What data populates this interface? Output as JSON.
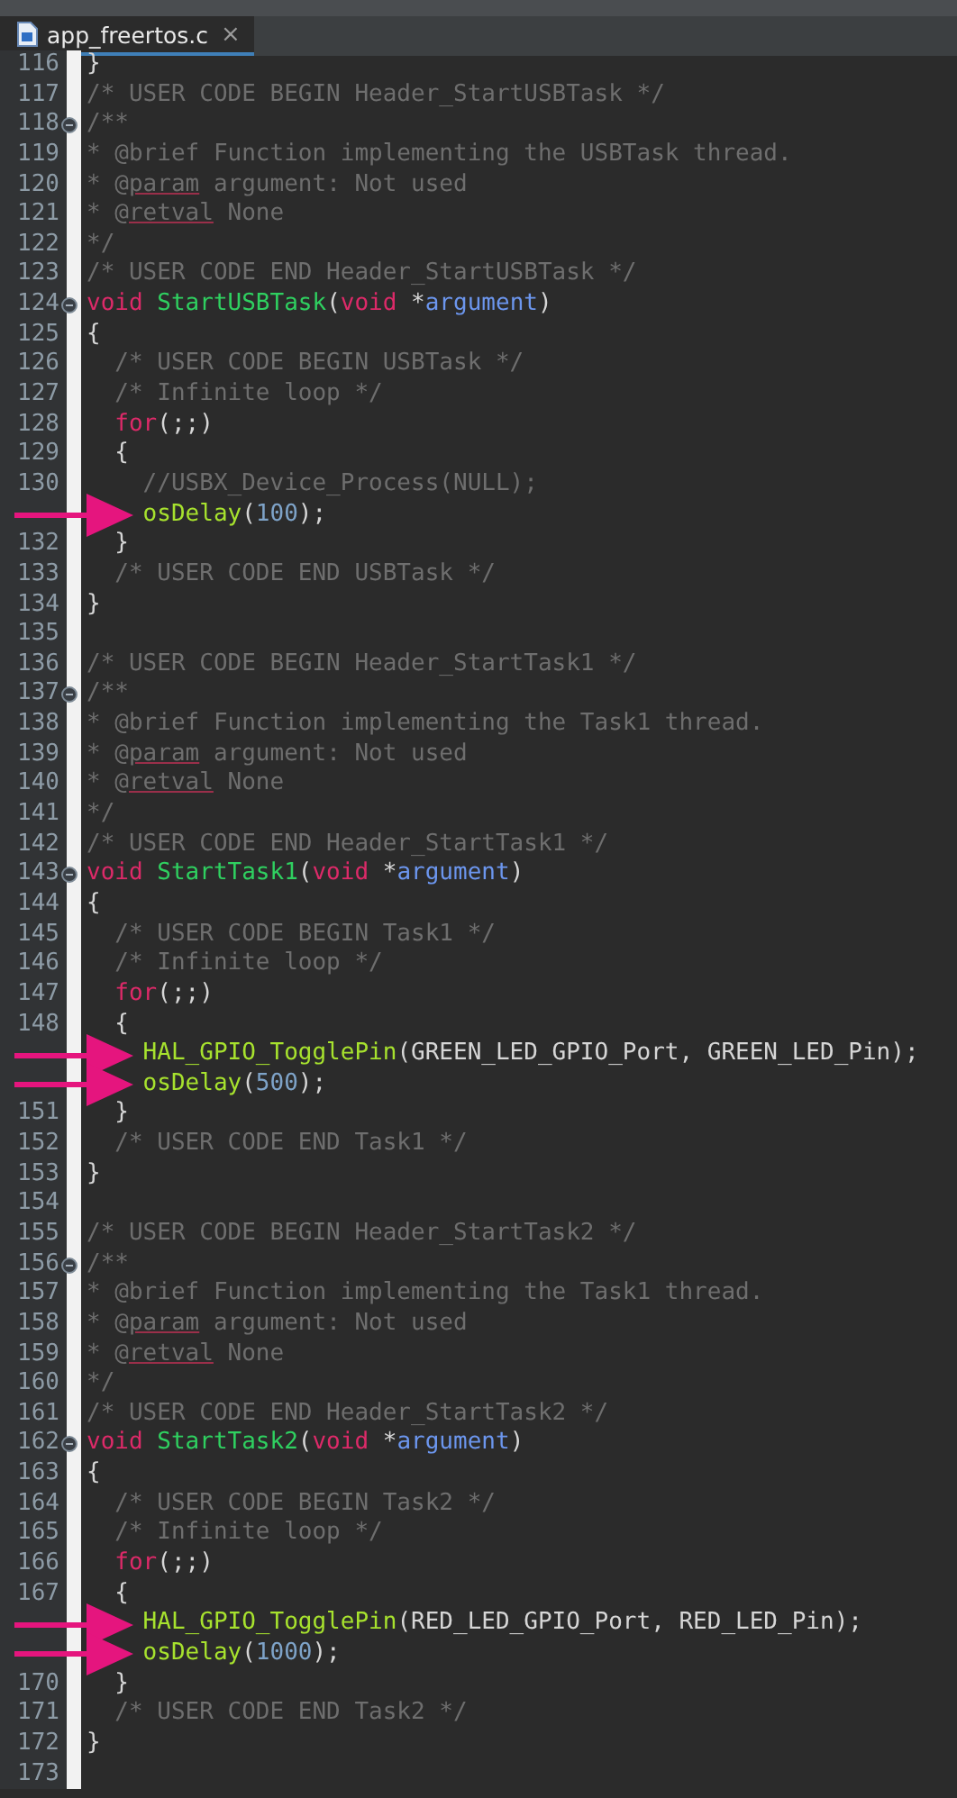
{
  "tab": {
    "label": "app_freertos.c",
    "close": "×",
    "selected": true
  },
  "lines": [
    {
      "number": "116",
      "collapsible": false,
      "arrow": false,
      "tokens": [
        {
          "kind": "plain",
          "text": "}"
        }
      ]
    },
    {
      "number": "117",
      "collapsible": false,
      "arrow": false,
      "tokens": [
        {
          "kind": "comment",
          "text": "/* USER CODE BEGIN Header_StartUSBTask */"
        }
      ]
    },
    {
      "number": "118",
      "collapsible": true,
      "arrow": false,
      "tokens": [
        {
          "kind": "comment",
          "text": "/**"
        }
      ]
    },
    {
      "number": "119",
      "collapsible": false,
      "arrow": false,
      "tokens": [
        {
          "kind": "comment",
          "text": "* @brief Function implementing the USBTask thread."
        }
      ]
    },
    {
      "number": "120",
      "collapsible": false,
      "arrow": false,
      "tokens": [
        {
          "kind": "comment",
          "text": "* @"
        },
        {
          "kind": "misspelled",
          "text": "param"
        },
        {
          "kind": "comment",
          "text": " argument: Not used"
        }
      ]
    },
    {
      "number": "121",
      "collapsible": false,
      "arrow": false,
      "tokens": [
        {
          "kind": "comment",
          "text": "* @"
        },
        {
          "kind": "misspelled",
          "text": "retval"
        },
        {
          "kind": "comment",
          "text": " None"
        }
      ]
    },
    {
      "number": "122",
      "collapsible": false,
      "arrow": false,
      "tokens": [
        {
          "kind": "comment",
          "text": "*/"
        }
      ]
    },
    {
      "number": "123",
      "collapsible": false,
      "arrow": false,
      "tokens": [
        {
          "kind": "comment",
          "text": "/* USER CODE END Header_StartUSBTask */"
        }
      ]
    },
    {
      "number": "124",
      "collapsible": true,
      "arrow": false,
      "tokens": [
        {
          "kind": "keyword",
          "text": "void"
        },
        {
          "kind": "function",
          "text": " StartUSBTask"
        },
        {
          "kind": "plain",
          "text": "("
        },
        {
          "kind": "keyword",
          "text": "void"
        },
        {
          "kind": "plain",
          "text": " *"
        },
        {
          "kind": "parameter",
          "text": "argument"
        },
        {
          "kind": "plain",
          "text": ")"
        }
      ]
    },
    {
      "number": "125",
      "collapsible": false,
      "arrow": false,
      "tokens": [
        {
          "kind": "plain",
          "text": "{"
        }
      ]
    },
    {
      "number": "126",
      "collapsible": false,
      "arrow": false,
      "tokens": [
        {
          "kind": "comment",
          "text": "  /* USER CODE BEGIN USBTask */"
        }
      ]
    },
    {
      "number": "127",
      "collapsible": false,
      "arrow": false,
      "tokens": [
        {
          "kind": "comment",
          "text": "  /* Infinite loop */"
        }
      ]
    },
    {
      "number": "128",
      "collapsible": false,
      "arrow": false,
      "tokens": [
        {
          "kind": "keyword",
          "text": "  for"
        },
        {
          "kind": "plain",
          "text": "(;;)"
        }
      ]
    },
    {
      "number": "129",
      "collapsible": false,
      "arrow": false,
      "tokens": [
        {
          "kind": "plain",
          "text": "  {"
        }
      ]
    },
    {
      "number": "130",
      "collapsible": false,
      "arrow": false,
      "tokens": [
        {
          "kind": "comment",
          "text": "    //USBX_Device_Process(NULL);"
        }
      ]
    },
    {
      "collapsible": false,
      "arrow": true,
      "tokens": [
        {
          "kind": "call",
          "text": "    osDelay"
        },
        {
          "kind": "plain",
          "text": "("
        },
        {
          "kind": "number",
          "text": "100"
        },
        {
          "kind": "plain",
          "text": ");"
        }
      ]
    },
    {
      "number": "132",
      "collapsible": false,
      "arrow": false,
      "tokens": [
        {
          "kind": "plain",
          "text": "  }"
        }
      ]
    },
    {
      "number": "133",
      "collapsible": false,
      "arrow": false,
      "tokens": [
        {
          "kind": "comment",
          "text": "  /* USER CODE END USBTask */"
        }
      ]
    },
    {
      "number": "134",
      "collapsible": false,
      "arrow": false,
      "tokens": [
        {
          "kind": "plain",
          "text": "}"
        }
      ]
    },
    {
      "number": "135",
      "collapsible": false,
      "arrow": false
    },
    {
      "number": "136",
      "collapsible": false,
      "arrow": false,
      "tokens": [
        {
          "kind": "comment",
          "text": "/* USER CODE BEGIN Header_StartTask1 */"
        }
      ]
    },
    {
      "number": "137",
      "collapsible": true,
      "arrow": false,
      "tokens": [
        {
          "kind": "comment",
          "text": "/**"
        }
      ]
    },
    {
      "number": "138",
      "collapsible": false,
      "arrow": false,
      "tokens": [
        {
          "kind": "comment",
          "text": "* @brief Function implementing the Task1 thread."
        }
      ]
    },
    {
      "number": "139",
      "collapsible": false,
      "arrow": false,
      "tokens": [
        {
          "kind": "comment",
          "text": "* @"
        },
        {
          "kind": "misspelled",
          "text": "param"
        },
        {
          "kind": "comment",
          "text": " argument: Not used"
        }
      ]
    },
    {
      "number": "140",
      "collapsible": false,
      "arrow": false,
      "tokens": [
        {
          "kind": "comment",
          "text": "* @"
        },
        {
          "kind": "misspelled",
          "text": "retval"
        },
        {
          "kind": "comment",
          "text": " None"
        }
      ]
    },
    {
      "number": "141",
      "collapsible": false,
      "arrow": false,
      "tokens": [
        {
          "kind": "comment",
          "text": "*/"
        }
      ]
    },
    {
      "number": "142",
      "collapsible": false,
      "arrow": false,
      "tokens": [
        {
          "kind": "comment",
          "text": "/* USER CODE END Header_StartTask1 */"
        }
      ]
    },
    {
      "number": "143",
      "collapsible": true,
      "arrow": false,
      "tokens": [
        {
          "kind": "keyword",
          "text": "void"
        },
        {
          "kind": "function",
          "text": " StartTask1"
        },
        {
          "kind": "plain",
          "text": "("
        },
        {
          "kind": "keyword",
          "text": "void"
        },
        {
          "kind": "plain",
          "text": " *"
        },
        {
          "kind": "parameter",
          "text": "argument"
        },
        {
          "kind": "plain",
          "text": ")"
        }
      ]
    },
    {
      "number": "144",
      "collapsible": false,
      "arrow": false,
      "tokens": [
        {
          "kind": "plain",
          "text": "{"
        }
      ]
    },
    {
      "number": "145",
      "collapsible": false,
      "arrow": false,
      "tokens": [
        {
          "kind": "comment",
          "text": "  /* USER CODE BEGIN Task1 */"
        }
      ]
    },
    {
      "number": "146",
      "collapsible": false,
      "arrow": false,
      "tokens": [
        {
          "kind": "comment",
          "text": "  /* Infinite loop */"
        }
      ]
    },
    {
      "number": "147",
      "collapsible": false,
      "arrow": false,
      "tokens": [
        {
          "kind": "keyword",
          "text": "  for"
        },
        {
          "kind": "plain",
          "text": "(;;)"
        }
      ]
    },
    {
      "number": "148",
      "collapsible": false,
      "arrow": false,
      "tokens": [
        {
          "kind": "plain",
          "text": "  {"
        }
      ]
    },
    {
      "collapsible": false,
      "arrow": true,
      "tokens": [
        {
          "kind": "call",
          "text": "    HAL_GPIO_TogglePin"
        },
        {
          "kind": "plain",
          "text": "(GREEN_LED_GPIO_Port, GREEN_LED_Pin);"
        }
      ]
    },
    {
      "collapsible": false,
      "arrow": true,
      "tokens": [
        {
          "kind": "call",
          "text": "    osDelay"
        },
        {
          "kind": "plain",
          "text": "("
        },
        {
          "kind": "number",
          "text": "500"
        },
        {
          "kind": "plain",
          "text": ");"
        }
      ]
    },
    {
      "number": "151",
      "collapsible": false,
      "arrow": false,
      "tokens": [
        {
          "kind": "plain",
          "text": "  }"
        }
      ]
    },
    {
      "number": "152",
      "collapsible": false,
      "arrow": false,
      "tokens": [
        {
          "kind": "comment",
          "text": "  /* USER CODE END Task1 */"
        }
      ]
    },
    {
      "number": "153",
      "collapsible": false,
      "arrow": false,
      "tokens": [
        {
          "kind": "plain",
          "text": "}"
        }
      ]
    },
    {
      "number": "154",
      "collapsible": false,
      "arrow": false
    },
    {
      "number": "155",
      "collapsible": false,
      "arrow": false,
      "tokens": [
        {
          "kind": "comment",
          "text": "/* USER CODE BEGIN Header_StartTask2 */"
        }
      ]
    },
    {
      "number": "156",
      "collapsible": true,
      "arrow": false,
      "tokens": [
        {
          "kind": "comment",
          "text": "/**"
        }
      ]
    },
    {
      "number": "157",
      "collapsible": false,
      "arrow": false,
      "tokens": [
        {
          "kind": "comment",
          "text": "* @brief Function implementing the Task1 thread."
        }
      ]
    },
    {
      "number": "158",
      "collapsible": false,
      "arrow": false,
      "tokens": [
        {
          "kind": "comment",
          "text": "* @"
        },
        {
          "kind": "misspelled",
          "text": "param"
        },
        {
          "kind": "comment",
          "text": " argument: Not used"
        }
      ]
    },
    {
      "number": "159",
      "collapsible": false,
      "arrow": false,
      "tokens": [
        {
          "kind": "comment",
          "text": "* @"
        },
        {
          "kind": "misspelled",
          "text": "retval"
        },
        {
          "kind": "comment",
          "text": " None"
        }
      ]
    },
    {
      "number": "160",
      "collapsible": false,
      "arrow": false,
      "tokens": [
        {
          "kind": "comment",
          "text": "*/"
        }
      ]
    },
    {
      "number": "161",
      "collapsible": false,
      "arrow": false,
      "tokens": [
        {
          "kind": "comment",
          "text": "/* USER CODE END Header_StartTask2 */"
        }
      ]
    },
    {
      "number": "162",
      "collapsible": true,
      "arrow": false,
      "tokens": [
        {
          "kind": "keyword",
          "text": "void"
        },
        {
          "kind": "function",
          "text": " StartTask2"
        },
        {
          "kind": "plain",
          "text": "("
        },
        {
          "kind": "keyword",
          "text": "void"
        },
        {
          "kind": "plain",
          "text": " *"
        },
        {
          "kind": "parameter",
          "text": "argument"
        },
        {
          "kind": "plain",
          "text": ")"
        }
      ]
    },
    {
      "number": "163",
      "collapsible": false,
      "arrow": false,
      "tokens": [
        {
          "kind": "plain",
          "text": "{"
        }
      ]
    },
    {
      "number": "164",
      "collapsible": false,
      "arrow": false,
      "tokens": [
        {
          "kind": "comment",
          "text": "  /* USER CODE BEGIN Task2 */"
        }
      ]
    },
    {
      "number": "165",
      "collapsible": false,
      "arrow": false,
      "tokens": [
        {
          "kind": "comment",
          "text": "  /* Infinite loop */"
        }
      ]
    },
    {
      "number": "166",
      "collapsible": false,
      "arrow": false,
      "tokens": [
        {
          "kind": "keyword",
          "text": "  for"
        },
        {
          "kind": "plain",
          "text": "(;;)"
        }
      ]
    },
    {
      "number": "167",
      "collapsible": false,
      "arrow": false,
      "tokens": [
        {
          "kind": "plain",
          "text": "  {"
        }
      ]
    },
    {
      "collapsible": false,
      "arrow": true,
      "tokens": [
        {
          "kind": "call",
          "text": "    HAL_GPIO_TogglePin"
        },
        {
          "kind": "plain",
          "text": "(RED_LED_GPIO_Port, RED_LED_Pin);"
        }
      ]
    },
    {
      "collapsible": false,
      "arrow": true,
      "tokens": [
        {
          "kind": "call",
          "text": "    osDelay"
        },
        {
          "kind": "plain",
          "text": "("
        },
        {
          "kind": "number",
          "text": "1000"
        },
        {
          "kind": "plain",
          "text": ");"
        }
      ]
    },
    {
      "number": "170",
      "collapsible": false,
      "arrow": false,
      "tokens": [
        {
          "kind": "plain",
          "text": "  }"
        }
      ]
    },
    {
      "number": "171",
      "collapsible": false,
      "arrow": false,
      "tokens": [
        {
          "kind": "comment",
          "text": "  /* USER CODE END Task2 */"
        }
      ]
    },
    {
      "number": "172",
      "collapsible": false,
      "arrow": false,
      "tokens": [
        {
          "kind": "plain",
          "text": "}"
        }
      ]
    },
    {
      "number": "173",
      "collapsible": false,
      "arrow": false
    }
  ]
}
